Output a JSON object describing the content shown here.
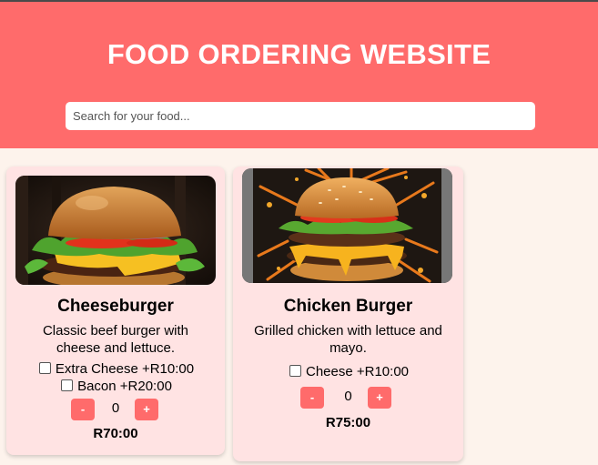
{
  "header": {
    "title": "FOOD ORDERING WEBSITE",
    "search_placeholder": "Search for your food..."
  },
  "colors": {
    "header_bg": "#ff6b6b",
    "card_bg": "#ffe3e3",
    "button_bg": "#ff6b6b",
    "page_bg": "#fdf3ec"
  },
  "products": [
    {
      "name": "Cheeseburger",
      "description": "Classic beef burger with cheese and lettuce.",
      "options": [
        {
          "label": "Extra Cheese +R10:00",
          "checked": false
        },
        {
          "label": "Bacon +R20:00",
          "checked": false
        }
      ],
      "minus_label": "-",
      "plus_label": "+",
      "quantity": "0",
      "price": "R70:00",
      "image_icon": "cheeseburger-photo"
    },
    {
      "name": "Chicken Burger",
      "description": "Grilled chicken with lettuce and mayo.",
      "options": [
        {
          "label": "Cheese +R10:00",
          "checked": false
        }
      ],
      "minus_label": "-",
      "plus_label": "+",
      "quantity": "0",
      "price": "R75:00",
      "image_icon": "chicken-burger-photo"
    }
  ]
}
